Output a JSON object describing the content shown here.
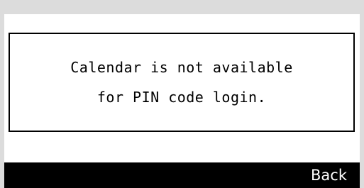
{
  "message": {
    "line1": "Calendar is not available",
    "line2": "for PIN code login."
  },
  "softkeys": {
    "back_label": "Back"
  },
  "colors": {
    "bezel": "#dcdcdc",
    "display_bg": "#ffffff",
    "text": "#000000",
    "softkey_bar": "#000000",
    "softkey_text": "#ffffff"
  }
}
